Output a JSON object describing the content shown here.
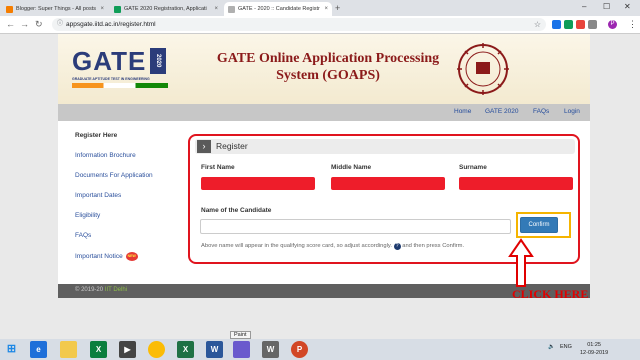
{
  "browser": {
    "tabs": [
      {
        "title": "Blogger: Super Things - All posts",
        "close": "×"
      },
      {
        "title": "GATE 2020 Registration, Applicati",
        "close": "×"
      },
      {
        "title": "GATE - 2020 :: Candidate Registr",
        "close": "×"
      }
    ],
    "new_tab": "+",
    "window_controls": {
      "minimize": "–",
      "maximize": "☐",
      "close": "✕"
    },
    "url": "appsgate.iitd.ac.in/register.html",
    "back": "←",
    "forward": "→",
    "reload": "↻",
    "profile_initial": "P",
    "menu": "⋮"
  },
  "site": {
    "logo_text": "GATE",
    "logo_year": "2020",
    "logo_subtitle": "GRADUATE APTITUDE TEST IN ENGINEERING",
    "title_line1": "GATE Online Application Processing",
    "title_line2": "System (GOAPS)",
    "emblem_text": "Institution of Eminence",
    "nav": [
      "Home",
      "GATE 2020",
      "FAQs",
      "Login"
    ]
  },
  "sidebar": {
    "items": [
      {
        "label": "Register Here"
      },
      {
        "label": "Information Brochure"
      },
      {
        "label": "Documents For Application"
      },
      {
        "label": "Important Dates"
      },
      {
        "label": "Eligibility"
      },
      {
        "label": "FAQs"
      },
      {
        "label": "Important Notice"
      }
    ],
    "new_badge": "NEW"
  },
  "form": {
    "heading": "Register",
    "arrow": "›",
    "first_name_label": "First Name",
    "middle_name_label": "Middle Name",
    "surname_label": "Surname",
    "candidate_label": "Name of the Candidate",
    "candidate_value": "",
    "confirm_label": "Confirm",
    "hint_before": "Above name will appear in the qualifying score card, so adjust accordingly.",
    "hint_icon": "?",
    "hint_after": "and then press Confirm."
  },
  "footer": {
    "copyright": "© 2019-20",
    "org": "IIT Delhi"
  },
  "annotation": {
    "label": "CLICK HERE"
  },
  "tooltip": "Paint",
  "taskbar": {
    "tray_lang": "ENG",
    "time": "01:25",
    "date": "12-09-2019"
  },
  "colors": {
    "highlight_red": "#e0141e",
    "highlight_yellow": "#f5b400",
    "confirm_blue": "#337ab7",
    "title_maroon": "#8b1a1a"
  }
}
